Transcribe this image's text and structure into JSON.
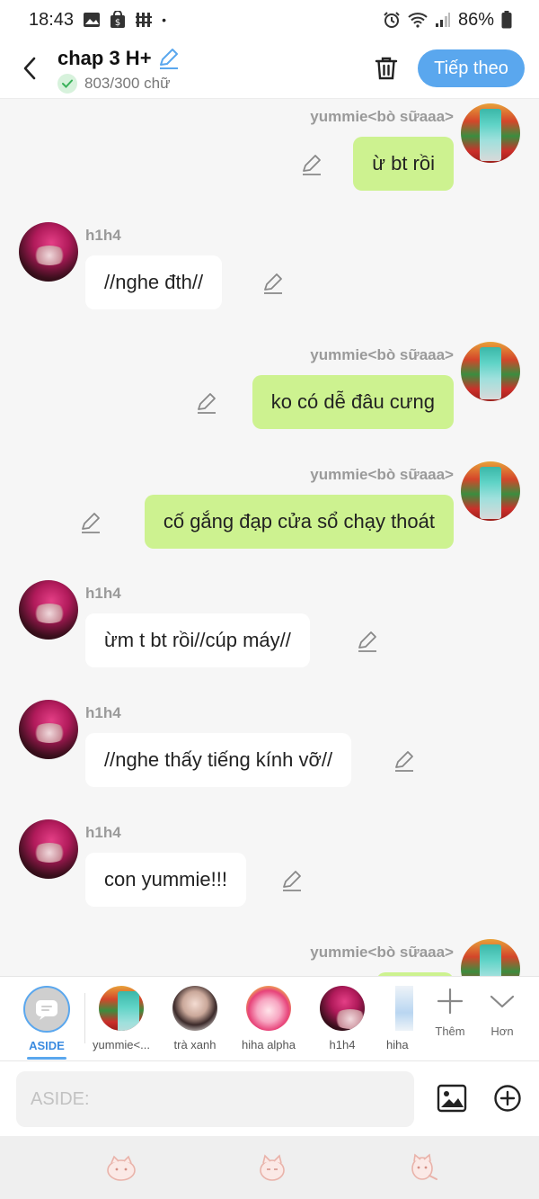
{
  "status_bar": {
    "time": "18:43",
    "dot": "•",
    "battery": "86%"
  },
  "header": {
    "title": "chap 3 H+",
    "count": "803/300 chữ",
    "next_label": "Tiếp theo"
  },
  "messages": [
    {
      "from": "me",
      "sender": "yummie<bò sữaaa>",
      "text": "ừ bt rồi"
    },
    {
      "from": "h1",
      "sender": "h1h4",
      "text": "//nghe đth//"
    },
    {
      "from": "me",
      "sender": "yummie<bò sữaaa>",
      "text": "ko có dễ đâu cưng"
    },
    {
      "from": "me",
      "sender": "yummie<bò sữaaa>",
      "text": "cố gắng đạp cửa sổ chạy thoát"
    },
    {
      "from": "h1",
      "sender": "h1h4",
      "text": "ừm t bt rồi//cúp máy//"
    },
    {
      "from": "h1",
      "sender": "h1h4",
      "text": "//nghe thấy tiếng kính vỡ//"
    },
    {
      "from": "h1",
      "sender": "h1h4",
      "text": "con yummie!!!"
    },
    {
      "from": "me",
      "sender": "yummie<bò sữaaa>",
      "text": ""
    }
  ],
  "characters": {
    "aside": "ASIDE",
    "items": [
      "yummie<...",
      "trà xanh",
      "hiha alpha",
      "h1h4",
      "hiha"
    ],
    "more_label": "Thêm",
    "less_label": "Hơn"
  },
  "input": {
    "placeholder": "ASIDE:"
  },
  "colors": {
    "accent": "#5aa7ee",
    "my_bubble": "#cdf290",
    "their_bubble": "#ffffff"
  }
}
